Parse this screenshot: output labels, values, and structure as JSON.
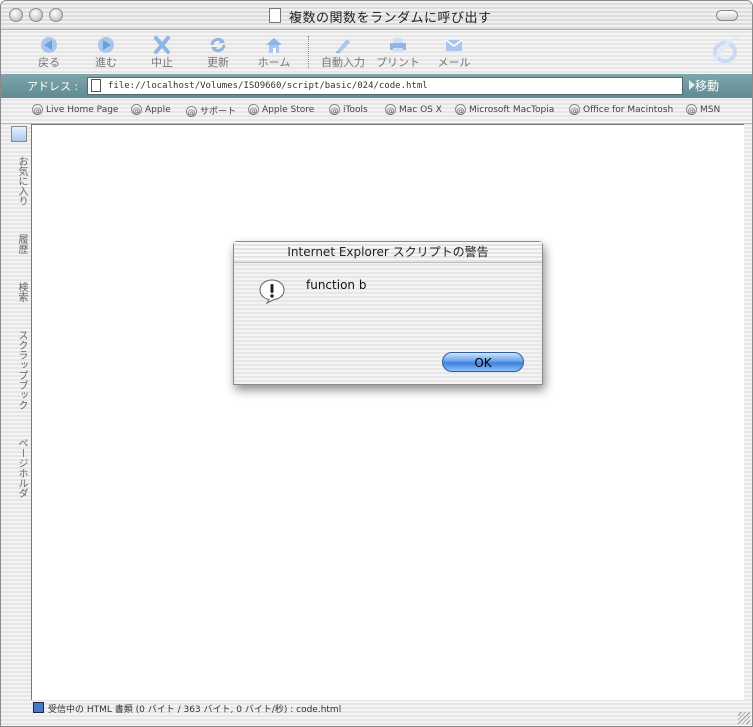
{
  "window": {
    "title": "複数の関数をランダムに呼び出す"
  },
  "toolbar": {
    "buttons": [
      {
        "label": "戻る",
        "icon": "back-arrow-icon"
      },
      {
        "label": "進む",
        "icon": "forward-arrow-icon"
      },
      {
        "label": "中止",
        "icon": "stop-icon"
      },
      {
        "label": "更新",
        "icon": "refresh-icon"
      },
      {
        "label": "ホーム",
        "icon": "home-icon"
      },
      {
        "label": "自動入力",
        "icon": "autofill-icon"
      },
      {
        "label": "プリント",
        "icon": "print-icon"
      },
      {
        "label": "メール",
        "icon": "mail-icon"
      }
    ]
  },
  "address": {
    "label": "アドレス :",
    "url": "file://localhost/Volumes/ISO9660/script/basic/024/code.html",
    "go_label": "移動"
  },
  "favorites": [
    "Live Home Page",
    "Apple",
    "サポート",
    "Apple Store",
    "iTools",
    "Mac OS X",
    "Microsoft MacTopia",
    "Office for Macintosh",
    "MSN"
  ],
  "explorer_tabs": [
    "お気に入り",
    "履歴",
    "検索",
    "スクラップブック",
    "ページホルダ"
  ],
  "dialog": {
    "title": "Internet Explorer スクリプトの警告",
    "message": "function b",
    "ok_label": "OK"
  },
  "status": {
    "text": "受信中の HTML 書類 (0 バイト / 363 バイト, 0 バイト/秒) : code.html"
  },
  "colors": {
    "address_bar": "#6f98a0",
    "ok_button": "#3b80e0"
  }
}
